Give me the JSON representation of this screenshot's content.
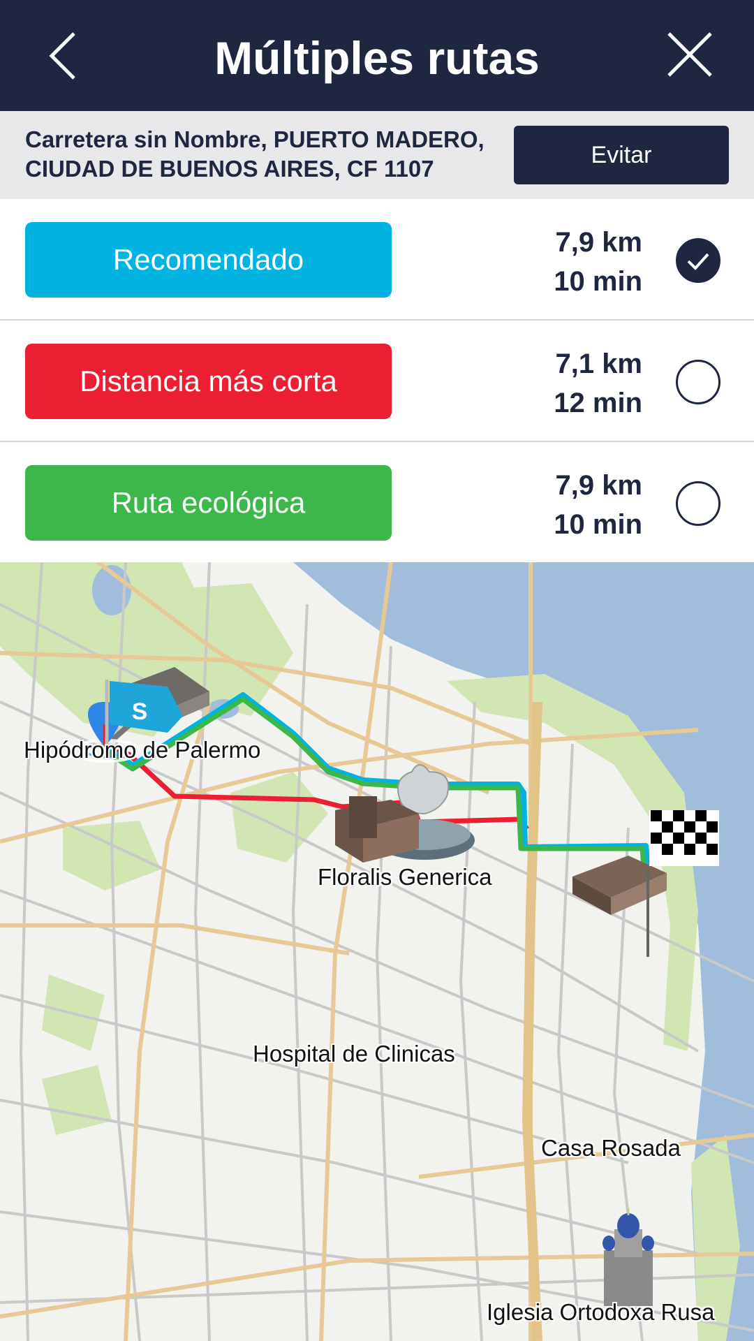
{
  "header": {
    "title": "Múltiples rutas",
    "back_icon": "chevron-left-icon",
    "close_icon": "close-icon"
  },
  "address": {
    "line1": "Carretera sin Nombre, PUERTO MADERO,",
    "line2": "CIUDAD DE BUENOS AIRES, CF 1107",
    "avoid_label": "Evitar"
  },
  "routes": [
    {
      "label": "Recomendado",
      "distance": "7,9 km",
      "time": "10 min",
      "color": "#00b3e0",
      "selected": true
    },
    {
      "label": "Distancia más corta",
      "distance": "7,1 km",
      "time": "12 min",
      "color": "#ec1e31",
      "selected": false
    },
    {
      "label": "Ruta ecológica",
      "distance": "7,9 km",
      "time": "10 min",
      "color": "#3cb84a",
      "selected": false
    }
  ],
  "map": {
    "start_marker_letter": "S",
    "labels": {
      "hipodromo": "Hipódromo de Palermo",
      "floralis": "Floralis Generica",
      "hospital": "Hospital de Clinicas",
      "casa_rosada": "Casa Rosada",
      "iglesia": "Iglesia Ortodoxa Rusa"
    }
  },
  "colors": {
    "navy": "#1e2640",
    "water": "#a2bddb",
    "park": "#d2e6b4"
  }
}
